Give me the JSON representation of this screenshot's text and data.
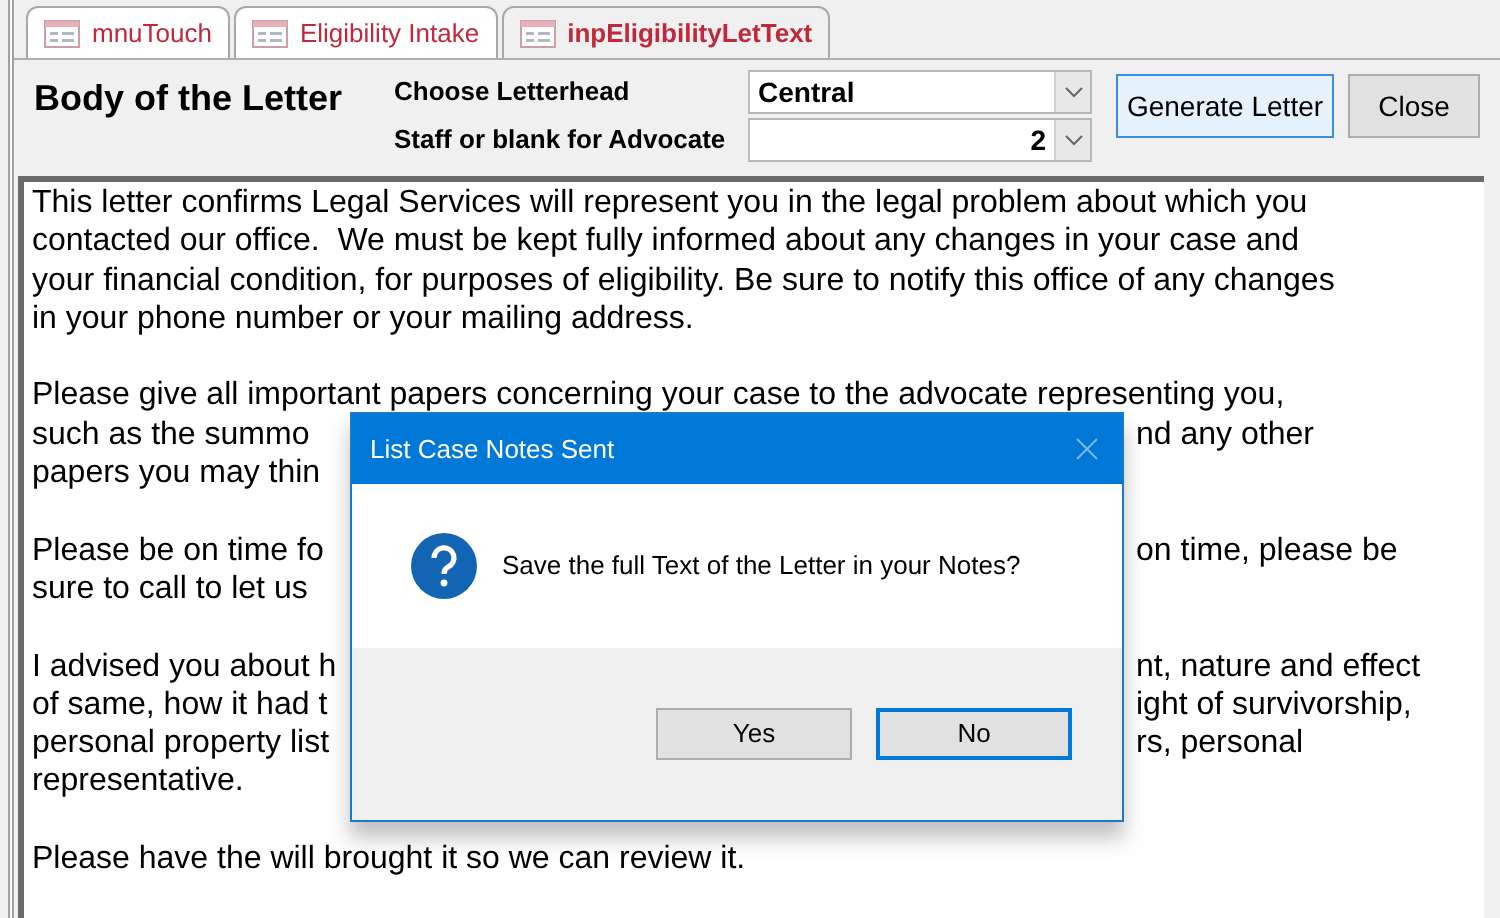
{
  "tabs": [
    {
      "label": "mnuTouch",
      "selected": false
    },
    {
      "label": "Eligibility Intake",
      "selected": false
    },
    {
      "label": "inpEligibilityLetText",
      "selected": true
    }
  ],
  "form": {
    "title": "Body of the Letter",
    "letterhead_label": "Choose Letterhead",
    "letterhead_value": "Central",
    "staff_label": "Staff or blank for Advocate",
    "staff_value": "2",
    "buttons": [
      {
        "label": "Generate Letter",
        "selected": true
      },
      {
        "label": "Close",
        "selected": false
      }
    ]
  },
  "letter_paragraphs": [
    {
      "lines": [
        {
          "left": "This letter confirms Legal Services will represent you in the legal problem about which you"
        },
        {
          "left": "contacted our office.  We must be kept fully informed about any changes in your case and"
        },
        {
          "left": "your financial condition, for purposes of eligibility. Be sure to notify this office of any changes"
        },
        {
          "left": "in your phone number or your mailing address."
        }
      ]
    },
    {
      "lines": [
        {
          "left": "Please give all important papers concerning your case to the advocate representing you,"
        },
        {
          "left": "such as the summo",
          "right": "nd any other"
        },
        {
          "left": "papers you may thin"
        }
      ]
    },
    {
      "lines": [
        {
          "left": "Please be on time fo",
          "right": "on time, please be"
        },
        {
          "left": "sure to call to let us"
        }
      ]
    },
    {
      "lines": [
        {
          "left": "I advised you about h",
          "right": "nt, nature and effect"
        },
        {
          "left": "of same, how it had t",
          "right": "ight of survivorship,"
        },
        {
          "left": "personal property list",
          "right": "rs, personal"
        },
        {
          "left": "representative."
        }
      ]
    },
    {
      "lines": [
        {
          "left": "Please have the will brought it so we can review it."
        }
      ]
    }
  ],
  "dialog": {
    "title": "List Case Notes Sent",
    "message": "Save the full Text of the Letter in your Notes?",
    "buttons": [
      {
        "label": "Yes",
        "selected": false
      },
      {
        "label": "No",
        "selected": true
      }
    ]
  }
}
